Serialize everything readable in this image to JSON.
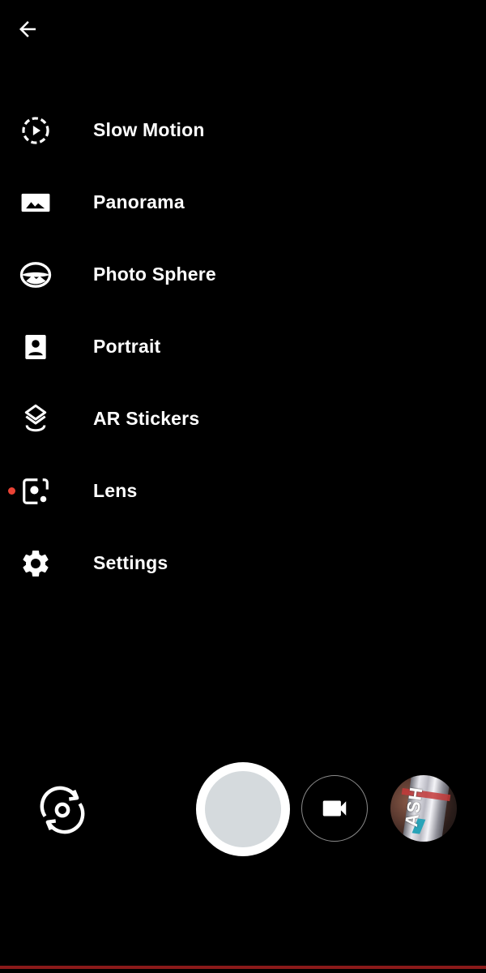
{
  "header": {
    "back_icon": "arrow-back-icon"
  },
  "menu": {
    "items": [
      {
        "label": "Slow Motion",
        "icon": "slow-motion-icon"
      },
      {
        "label": "Panorama",
        "icon": "panorama-icon"
      },
      {
        "label": "Photo Sphere",
        "icon": "photo-sphere-icon"
      },
      {
        "label": "Portrait",
        "icon": "portrait-icon"
      },
      {
        "label": "AR Stickers",
        "icon": "ar-stickers-icon"
      },
      {
        "label": "Lens",
        "icon": "lens-icon",
        "new_indicator": true
      },
      {
        "label": "Settings",
        "icon": "gear-icon"
      }
    ]
  },
  "controls": {
    "switch_camera_icon": "switch-camera-icon",
    "shutter": "shutter-button",
    "video_icon": "video-camera-icon",
    "thumbnail_brand": "ASH"
  },
  "colors": {
    "background": "#000000",
    "text": "#ffffff",
    "indicator": "#ea4335",
    "shutter_inner": "#d5dadd",
    "nav_line": "#8b1a1a"
  }
}
